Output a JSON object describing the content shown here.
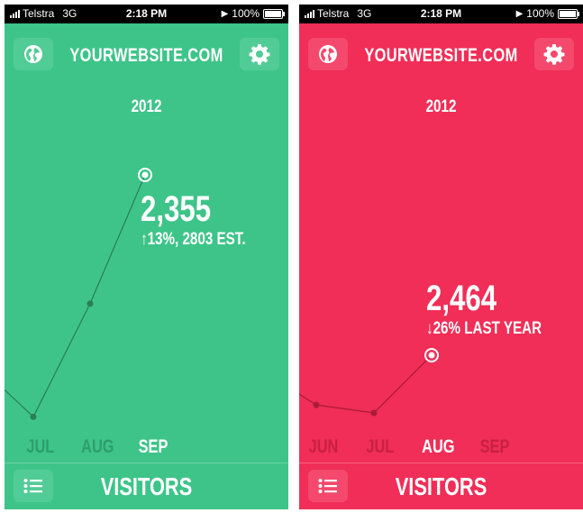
{
  "status_bar": {
    "carrier": "Telstra",
    "network": "3G",
    "time": "2:18 PM",
    "battery": "100%"
  },
  "screens": [
    {
      "id": "green",
      "colors": {
        "background": "#3ec489",
        "dark": "#2e9e6c",
        "point": "#2a7e57",
        "button": "#52cc96"
      },
      "site_title": "YOURWEBSITE.COM",
      "year": "2012",
      "value": "2,355",
      "change": "13%, 2803 EST.",
      "change_arrow": "up",
      "months": [
        {
          "label": "JUL",
          "visitors": 1650,
          "selected": false
        },
        {
          "label": "AUG",
          "visitors": 1980,
          "selected": false
        },
        {
          "label": "SEP",
          "visitors": 2355,
          "selected": true
        }
      ],
      "bottom_title": "VISITORS"
    },
    {
      "id": "red",
      "colors": {
        "background": "#f02e57",
        "dark": "#c8213f",
        "point": "#a91b36",
        "button": "#f4496c"
      },
      "site_title": "YOURWEBSITE.COM",
      "year": "2012",
      "value": "2,464",
      "change": "26% LAST YEAR",
      "change_arrow": "down",
      "months": [
        {
          "label": "JUN",
          "visitors": 2090,
          "selected": false
        },
        {
          "label": "JUL",
          "visitors": 2030,
          "selected": false
        },
        {
          "label": "AUG",
          "visitors": 2464,
          "selected": true
        },
        {
          "label": "SEP",
          "visitors": null,
          "selected": false
        }
      ],
      "bottom_title": "VISITORS"
    }
  ]
}
